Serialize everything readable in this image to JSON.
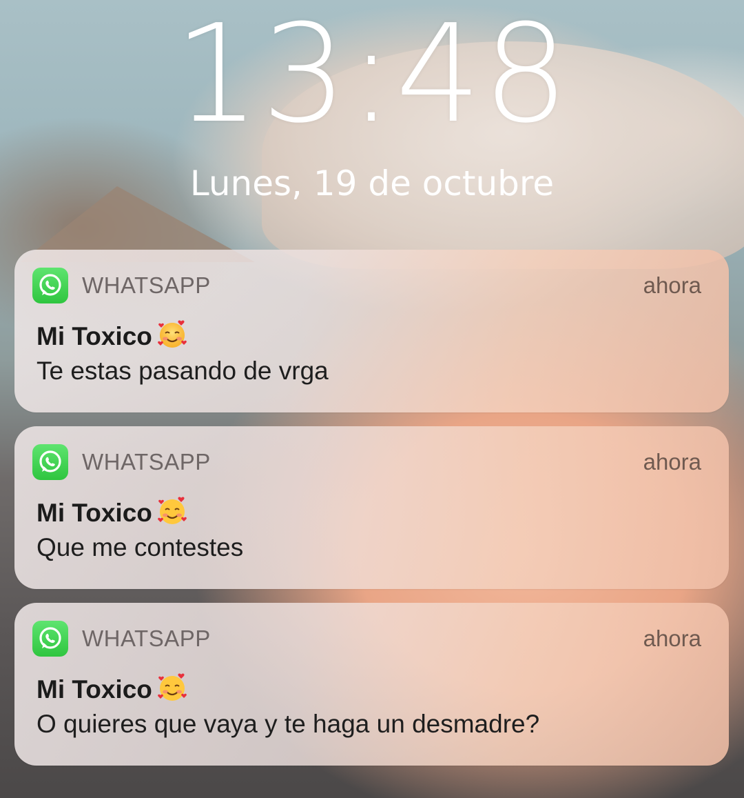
{
  "lockscreen": {
    "time": "13:48",
    "date": "Lunes, 19 de octubre"
  },
  "notifications": [
    {
      "app": "WHATSAPP",
      "app_icon": "whatsapp-icon",
      "time": "ahora",
      "sender": "Mi Toxico",
      "sender_emoji": "smiling-face-with-hearts",
      "message": "Te estas pasando de vrga"
    },
    {
      "app": "WHATSAPP",
      "app_icon": "whatsapp-icon",
      "time": "ahora",
      "sender": "Mi Toxico",
      "sender_emoji": "smiling-face-with-hearts",
      "message": "Que me contestes"
    },
    {
      "app": "WHATSAPP",
      "app_icon": "whatsapp-icon",
      "time": "ahora",
      "sender": "Mi Toxico",
      "sender_emoji": "smiling-face-with-hearts",
      "message": "O quieres que vaya y te haga un desmadre?"
    }
  ],
  "colors": {
    "whatsapp_green": "#2fc53f",
    "clock_text": "#ffffff"
  }
}
